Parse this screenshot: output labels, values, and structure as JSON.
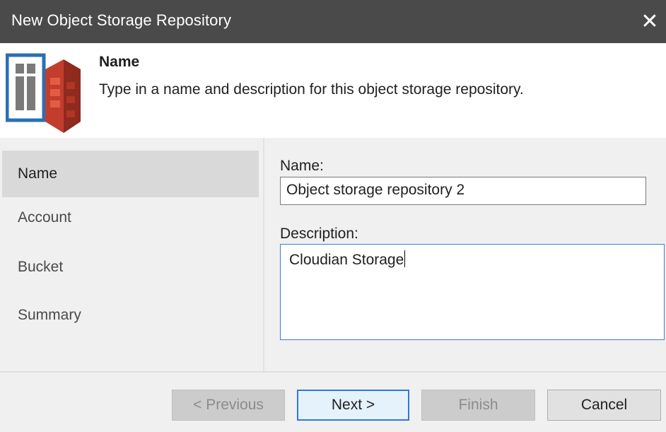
{
  "window": {
    "title": "New Object Storage Repository",
    "close_glyph": "✕"
  },
  "header": {
    "title": "Name",
    "description": "Type in a name and description for this object storage repository.",
    "icon": "object-storage-repository-icon"
  },
  "sidebar": {
    "items": [
      {
        "label": "Name",
        "active": true
      },
      {
        "label": "Account",
        "active": false
      },
      {
        "label": "Bucket",
        "active": false
      },
      {
        "label": "Summary",
        "active": false
      }
    ]
  },
  "form": {
    "name_label": "Name:",
    "name_value": "Object storage repository 2",
    "description_label": "Description:",
    "description_value": "Cloudian Storage"
  },
  "buttons": {
    "previous": "< Previous",
    "next": "Next >",
    "finish": "Finish",
    "cancel": "Cancel"
  },
  "colors": {
    "titlebar": "#4a4a4a",
    "accent": "#2f7ad6",
    "icon_red": "#d6412f",
    "icon_blue": "#2a6fb4"
  }
}
